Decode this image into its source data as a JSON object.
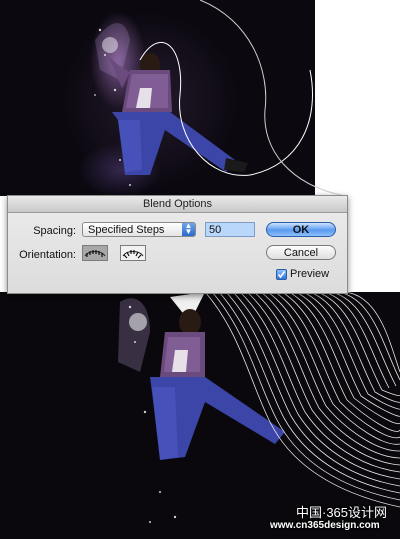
{
  "dialog": {
    "title": "Blend Options",
    "spacing_label": "Spacing:",
    "spacing_value": "Specified Steps",
    "steps_value": "50",
    "orientation_label": "Orientation:",
    "ok_label": "OK",
    "cancel_label": "Cancel",
    "preview_label": "Preview",
    "preview_checked": true
  },
  "watermark": {
    "site_name": "中国·365设计网",
    "url": "www.cn365design.com"
  },
  "colors": {
    "accent": "#4a8ae8",
    "input_highlight": "#b9d6fb",
    "artwork_bg": "#0b0810"
  },
  "icons": {
    "select_arrow": "updown-arrows-icon",
    "orient_page": "align-to-page-icon",
    "orient_path": "align-to-path-icon",
    "checkbox": "checkmark-icon"
  }
}
